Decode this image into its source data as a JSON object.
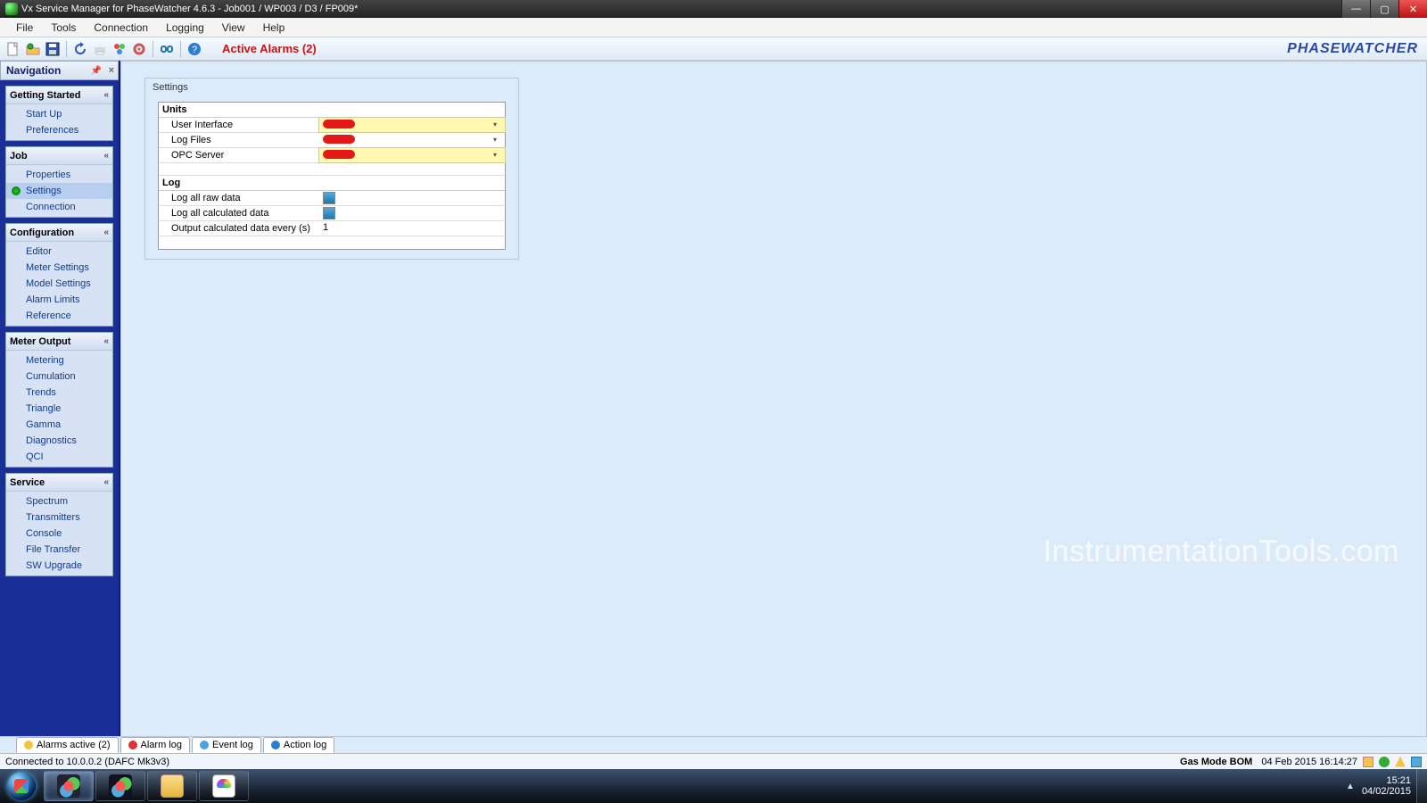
{
  "title": "Vx Service Manager for PhaseWatcher 4.6.3 - Job001 / WP003 / D3 / FP009*",
  "menus": [
    "File",
    "Tools",
    "Connection",
    "Logging",
    "View",
    "Help"
  ],
  "toolbar_alarms": "Active Alarms (2)",
  "brand": "PHASEWATCHER",
  "nav_title": "Navigation",
  "panels": [
    {
      "title": "Getting Started",
      "items": [
        "Start Up",
        "Preferences"
      ]
    },
    {
      "title": "Job",
      "items": [
        "Properties",
        "Settings",
        "Connection"
      ],
      "selected": 1
    },
    {
      "title": "Configuration",
      "items": [
        "Editor",
        "Meter Settings",
        "Model Settings",
        "Alarm Limits",
        "Reference"
      ]
    },
    {
      "title": "Meter Output",
      "items": [
        "Metering",
        "Cumulation",
        "Trends",
        "Triangle",
        "Gamma",
        "Diagnostics",
        "QCI"
      ]
    },
    {
      "title": "Service",
      "items": [
        "Spectrum",
        "Transmitters",
        "Console",
        "File Transfer",
        "SW Upgrade"
      ]
    }
  ],
  "settings": {
    "heading": "Settings",
    "sections": [
      {
        "name": "Units",
        "rows": [
          {
            "k": "User Interface",
            "type": "dropdown",
            "redacted": true,
            "highlight": true
          },
          {
            "k": "Log Files",
            "type": "dropdown",
            "redacted": true
          },
          {
            "k": "OPC Server",
            "type": "dropdown",
            "redacted": true,
            "highlight": true
          }
        ]
      },
      {
        "name": "Log",
        "rows": [
          {
            "k": "Log all raw data",
            "type": "check",
            "on": true
          },
          {
            "k": "Log all calculated data",
            "type": "check",
            "on": true
          },
          {
            "k": "Output calculated data every (s)",
            "type": "text",
            "v": "1"
          }
        ]
      }
    ]
  },
  "watermark": "InstrumentationTools.com",
  "bottom_tabs": [
    {
      "label": "Alarms active (2)",
      "color": "d-warn"
    },
    {
      "label": "Alarm log",
      "color": "d-red"
    },
    {
      "label": "Event log",
      "color": "d-blue"
    },
    {
      "label": "Action log",
      "color": "d-info"
    }
  ],
  "status_left": "Connected to 10.0.0.2 (DAFC Mk3v3)",
  "status_right_mode": "Gas Mode  BOM",
  "status_right_time": "04 Feb 2015 16:14:27",
  "tray_time": "15:21",
  "tray_date": "04/02/2015"
}
